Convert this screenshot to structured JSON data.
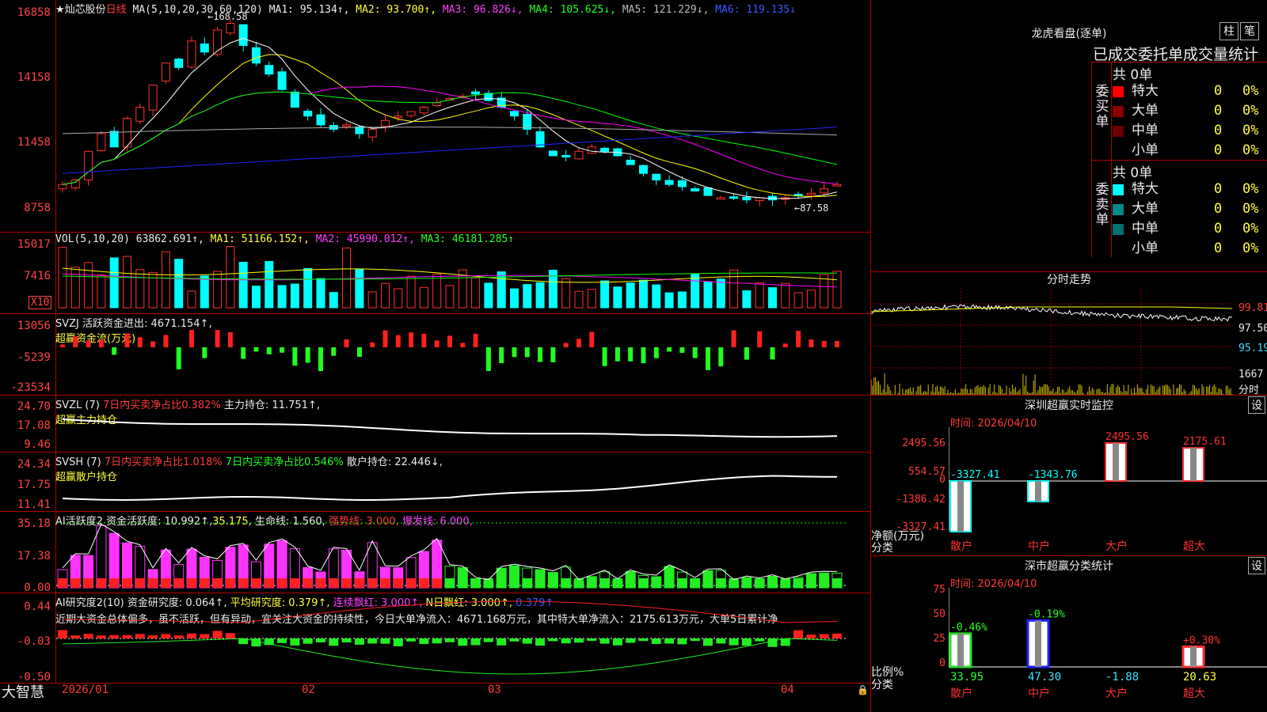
{
  "main": {
    "y_labels": [
      "16858",
      "14158",
      "11458",
      "8758"
    ],
    "stock_name": "★灿芯股份",
    "period": "日线",
    "ma_params": "MA(5,10,20,30,60,120)",
    "ma1": "MA1: 95.134↑,",
    "ma2": "MA2: 93.700↑,",
    "ma3": "MA3: 96.826↓,",
    "ma4": "MA4: 105.625↓,",
    "ma5": "MA5: 121.229↓,",
    "ma6": "MA6: 119.135↓",
    "high_label": "168.58",
    "low_label": "87.58",
    "colors": {
      "up": "#ff3030",
      "down": "#00ffff",
      "ma1": "#ffffff",
      "ma2": "#ffff00",
      "ma3": "#ff00ff",
      "ma4": "#00ff00",
      "ma5": "#aaaaaa",
      "ma6": "#2222ff"
    }
  },
  "vol": {
    "y_labels": [
      "15017",
      "7416"
    ],
    "unit_badge": "X10",
    "params": "VOL(5,10,20)",
    "value": "63862.691↑,",
    "ma1": "MA1: 51166.152↑,",
    "ma2": "MA2: 45990.012↑,",
    "ma3": "MA3: 46181.285↑"
  },
  "svzj": {
    "y_labels": [
      "13056",
      "-5239",
      "-23534"
    ],
    "line1": "SVZJ  活跃资金进出: 4671.154↑,",
    "line2": "超赢资金流(万元)"
  },
  "svzl": {
    "y_labels": [
      "24.70",
      "17.08",
      "9.46"
    ],
    "name": "SVZL (7)",
    "ratio": "7日内买卖净占比0.382%",
    "hold": "主力持仓: 11.751↑,",
    "sub": "超赢主力持仓"
  },
  "svsh": {
    "y_labels": [
      "24.34",
      "17.75",
      "11.41"
    ],
    "name": "SVSH (7)",
    "ratio1": "7日内买卖净占比1.018%",
    "ratio2": "7日内买卖净占比0.546%",
    "hold": "散户持仓: 22.446↓,",
    "sub": "超赢散户持仓"
  },
  "ai_active": {
    "y_labels": [
      "35.18",
      "17.38",
      "0.00"
    ],
    "name": "AI活跃度2",
    "v1": "资金活跃度: 10.992↑,",
    "v2": "35.175,",
    "v3": "生命线: 1.560,",
    "v4": "强势线: 3.000,",
    "v5": "爆发线: 6.000,"
  },
  "ai_research": {
    "y_labels": [
      "0.44",
      "-0.03",
      "-0.50"
    ],
    "name": "AI研究度2(10)",
    "v1": "资金研究度: 0.064↑,",
    "v2": "平均研究度: 0.379↑,",
    "v3": "连续飘红: 3.000↑,",
    "v4": "N日飘红: 3.000↑,",
    "v5": "0.379↑",
    "comment": "近期大资金总体偏多，虽不活跃，但有异动，宜关注大资金的持续性，今日大单净流入：4671.168万元，其中特大单净流入：2175.613万元，大单5日累计净"
  },
  "footer": {
    "brand": "大智慧",
    "dates": [
      "2026/01",
      "02",
      "03",
      "04"
    ]
  },
  "dragon": {
    "title": "龙虎看盘(逐单)",
    "btn_bar": "柱",
    "btn_pen": "笔",
    "tabs": "已成交委托单成交量统计",
    "buy_label": "委买单",
    "sell_label": "委卖单",
    "buy_total": "共 0单",
    "sell_total": "共 0单",
    "buy_rows": [
      {
        "name": "特大",
        "count": "0",
        "pct": "0%",
        "color": "#ff0000"
      },
      {
        "name": "大单",
        "count": "0",
        "pct": "0%",
        "color": "#8b0000"
      },
      {
        "name": "中单",
        "count": "0",
        "pct": "0%",
        "color": "#6b0000"
      },
      {
        "name": "小单",
        "count": "0",
        "pct": "0%",
        "color": "#000000"
      }
    ],
    "sell_rows": [
      {
        "name": "特大",
        "count": "0",
        "pct": "0%",
        "color": "#00ffff"
      },
      {
        "name": "大单",
        "count": "0",
        "pct": "0%",
        "color": "#008b8b"
      },
      {
        "name": "中单",
        "count": "0",
        "pct": "0%",
        "color": "#007070"
      },
      {
        "name": "小单",
        "count": "0",
        "pct": "0%",
        "color": "#000000"
      }
    ]
  },
  "intraday": {
    "title": "分时走势",
    "labels": [
      "99.81",
      "97.50",
      "95.19"
    ],
    "vol_label": "1667",
    "vol_unit": "分时"
  },
  "monitor": {
    "title": "深圳超赢实时监控",
    "set": "设",
    "time": "时间: 2026/04/10",
    "y_labels": [
      "2495.56",
      "554.57",
      "0",
      "-1386.42",
      "-3327.41"
    ],
    "net_label": "净额(万元)",
    "cat_label": "分类",
    "bars": [
      {
        "cat": "散户",
        "value": "-3327.41",
        "v": -3327.41,
        "color": "#00ffff"
      },
      {
        "cat": "中户",
        "value": "-1343.76",
        "v": -1343.76,
        "color": "#00ffff"
      },
      {
        "cat": "大户",
        "value": "2495.56",
        "v": 2495.56,
        "color": "#ff3030"
      },
      {
        "cat": "超大",
        "value": "2175.61",
        "v": 2175.61,
        "color": "#ff3030"
      }
    ]
  },
  "stats": {
    "title": "深市超赢分类统计",
    "set": "设",
    "time": "时间: 2026/04/10",
    "y_labels": [
      "75",
      "50",
      "25",
      "0"
    ],
    "ratio_label": "比例%",
    "cat_label": "分类",
    "bars": [
      {
        "cat": "散户",
        "value": "33.95",
        "change": "-0.46%",
        "v": 33.95,
        "color": "#22dd22"
      },
      {
        "cat": "中户",
        "value": "47.30",
        "change": "-0.19%",
        "v": 47.3,
        "color": "#2222ff"
      },
      {
        "cat": "大户",
        "value": "-1.88",
        "change": "",
        "v": 0,
        "color": "#ff3030"
      },
      {
        "cat": "超大",
        "value": "20.63",
        "change": "+0.30%",
        "v": 20.63,
        "color": "#ff3030"
      }
    ]
  }
}
